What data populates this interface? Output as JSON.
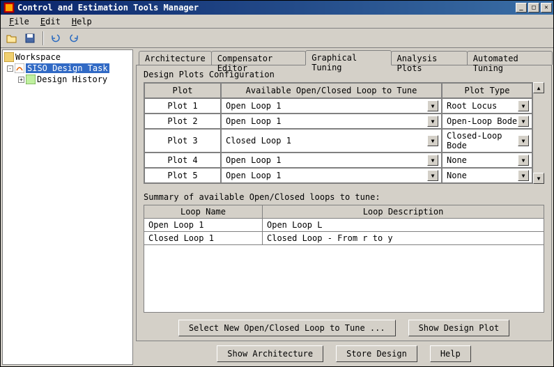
{
  "window": {
    "title": "Control and Estimation Tools Manager"
  },
  "menubar": [
    "File",
    "Edit",
    "Help"
  ],
  "tree": {
    "root": "Workspace",
    "task": "SISO Design Task",
    "history": "Design History"
  },
  "tabs": {
    "items": [
      "Architecture",
      "Compensator Editor",
      "Graphical Tuning",
      "Analysis Plots",
      "Automated Tuning"
    ],
    "activeIndex": 2
  },
  "section": {
    "config_label": "Design Plots Configuration",
    "headers": {
      "plot": "Plot",
      "loop": "Available Open/Closed Loop to Tune",
      "type": "Plot Type"
    },
    "rows": [
      {
        "plot": "Plot 1",
        "loop": "Open Loop 1",
        "type": "Root Locus"
      },
      {
        "plot": "Plot 2",
        "loop": "Open Loop 1",
        "type": "Open-Loop Bode"
      },
      {
        "plot": "Plot 3",
        "loop": "Closed Loop 1",
        "type": "Closed-Loop Bode"
      },
      {
        "plot": "Plot 4",
        "loop": "Open Loop 1",
        "type": "None"
      },
      {
        "plot": "Plot 5",
        "loop": "Open Loop 1",
        "type": "None"
      }
    ]
  },
  "summary": {
    "label": "Summary of available Open/Closed loops to tune:",
    "headers": {
      "name": "Loop Name",
      "desc": "Loop Description"
    },
    "rows": [
      {
        "name": "Open Loop 1",
        "desc": "Open Loop L"
      },
      {
        "name": "Closed Loop 1",
        "desc": "Closed Loop - From r to y"
      }
    ]
  },
  "buttons": {
    "select_loop": "Select New Open/Closed Loop to Tune ...",
    "show_plot": "Show Design Plot",
    "show_arch": "Show Architecture",
    "store": "Store Design",
    "help": "Help"
  }
}
